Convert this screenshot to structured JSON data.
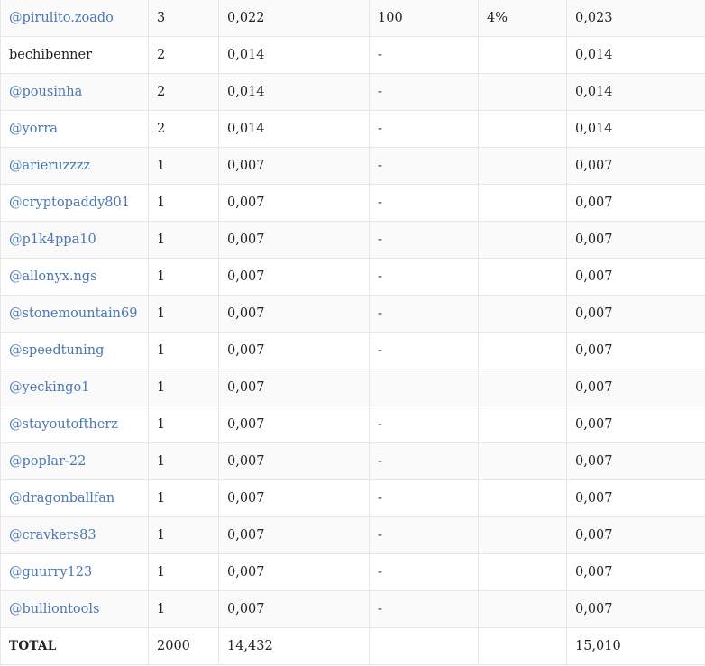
{
  "table": {
    "rows": [
      {
        "user": "@pirulito.zoado",
        "link": true,
        "c2": "3",
        "c3": "0,022",
        "c4": "100",
        "c5": "4%",
        "c6": "0,023"
      },
      {
        "user": "bechibenner",
        "link": false,
        "c2": "2",
        "c3": "0,014",
        "c4": "-",
        "c5": "",
        "c6": "0,014"
      },
      {
        "user": "@pousinha",
        "link": true,
        "c2": "2",
        "c3": "0,014",
        "c4": "-",
        "c5": "",
        "c6": "0,014"
      },
      {
        "user": "@yorra",
        "link": true,
        "c2": "2",
        "c3": "0,014",
        "c4": "-",
        "c5": "",
        "c6": "0,014"
      },
      {
        "user": "@arieruzzzz",
        "link": true,
        "c2": "1",
        "c3": "0,007",
        "c4": "-",
        "c5": "",
        "c6": "0,007"
      },
      {
        "user": "@cryptopaddy801",
        "link": true,
        "c2": "1",
        "c3": "0,007",
        "c4": "-",
        "c5": "",
        "c6": "0,007"
      },
      {
        "user": "@p1k4ppa10",
        "link": true,
        "c2": "1",
        "c3": "0,007",
        "c4": "-",
        "c5": "",
        "c6": "0,007"
      },
      {
        "user": "@allonyx.ngs",
        "link": true,
        "c2": "1",
        "c3": "0,007",
        "c4": "-",
        "c5": "",
        "c6": "0,007"
      },
      {
        "user": "@stonemountain69",
        "link": true,
        "c2": "1",
        "c3": "0,007",
        "c4": "-",
        "c5": "",
        "c6": "0,007"
      },
      {
        "user": "@speedtuning",
        "link": true,
        "c2": "1",
        "c3": "0,007",
        "c4": "-",
        "c5": "",
        "c6": "0,007"
      },
      {
        "user": "@yeckingo1",
        "link": true,
        "c2": "1",
        "c3": "0,007",
        "c4": "",
        "c5": "",
        "c6": "0,007"
      },
      {
        "user": "@stayoutoftherz",
        "link": true,
        "c2": "1",
        "c3": "0,007",
        "c4": "-",
        "c5": "",
        "c6": "0,007"
      },
      {
        "user": "@poplar-22",
        "link": true,
        "c2": "1",
        "c3": "0,007",
        "c4": "-",
        "c5": "",
        "c6": "0,007"
      },
      {
        "user": "@dragonballfan",
        "link": true,
        "c2": "1",
        "c3": "0,007",
        "c4": "-",
        "c5": "",
        "c6": "0,007"
      },
      {
        "user": "@cravkers83",
        "link": true,
        "c2": "1",
        "c3": "0,007",
        "c4": "-",
        "c5": "",
        "c6": "0,007"
      },
      {
        "user": "@guurry123",
        "link": true,
        "c2": "1",
        "c3": "0,007",
        "c4": "-",
        "c5": "",
        "c6": "0,007"
      },
      {
        "user": "@bulliontools",
        "link": true,
        "c2": "1",
        "c3": "0,007",
        "c4": "-",
        "c5": "",
        "c6": "0,007"
      }
    ],
    "total": {
      "label": "TOTAL",
      "c2": "2000",
      "c3": "14,432",
      "c4": "",
      "c5": "",
      "c6": "15,010"
    }
  },
  "colors": {
    "link": "#4a78b5",
    "text": "#222222",
    "border": "#e6e6e6",
    "stripe": "#fafafa"
  }
}
